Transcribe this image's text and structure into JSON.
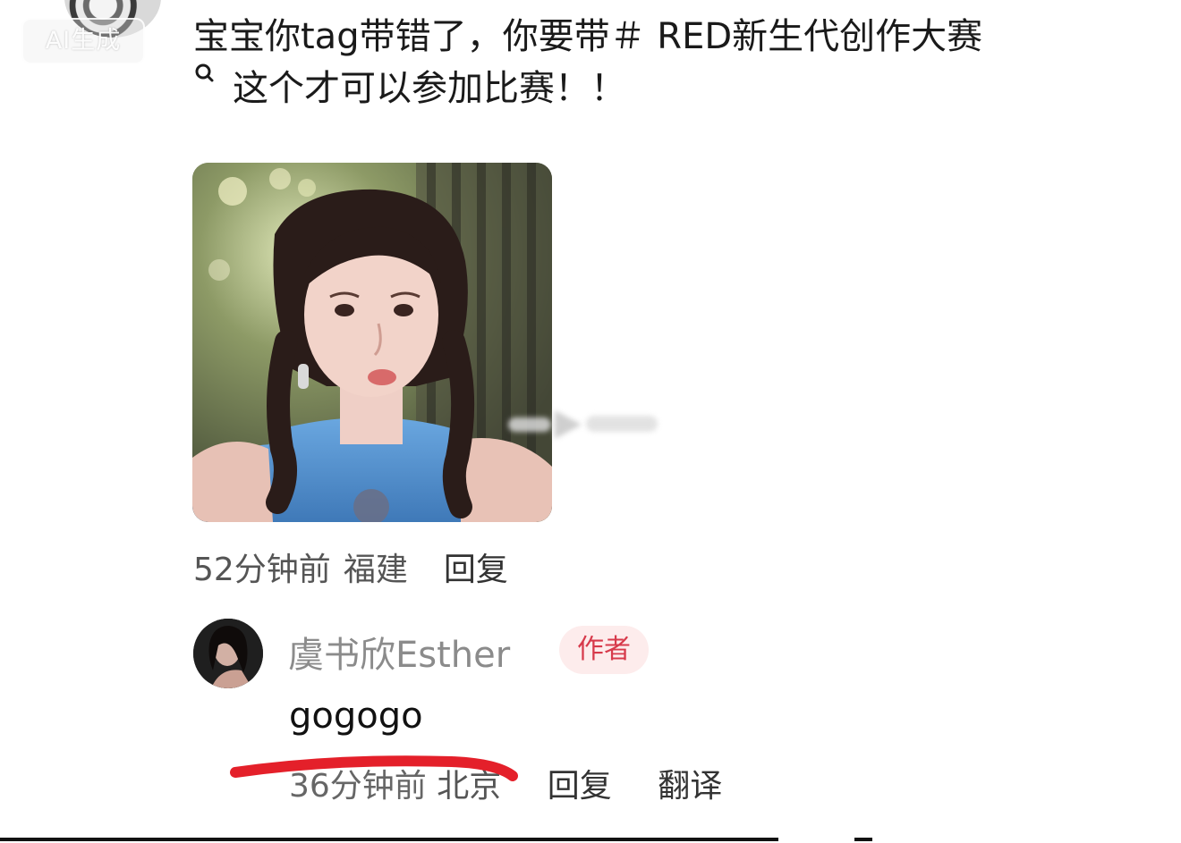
{
  "badge": {
    "ai_label": "AI生成"
  },
  "comment": {
    "line1": "宝宝你tag带错了，你要带＃ RED新生代创作大赛",
    "line2": "这个才可以参加比赛！！",
    "time": "52分钟前",
    "location": "福建",
    "reply_label": "回复"
  },
  "reply": {
    "author_name": "虞书欣Esther",
    "author_tag": "作者",
    "text": "gogogo",
    "time": "36分钟前",
    "location": "北京",
    "reply_label": "回复",
    "translate_label": "翻译"
  },
  "icons": {
    "search": "search-icon",
    "cursor": "cursor-icon"
  },
  "colors": {
    "author_tag_bg": "#fdecec",
    "author_tag_text": "#d73a4b",
    "underline_mark": "#e4202a"
  }
}
